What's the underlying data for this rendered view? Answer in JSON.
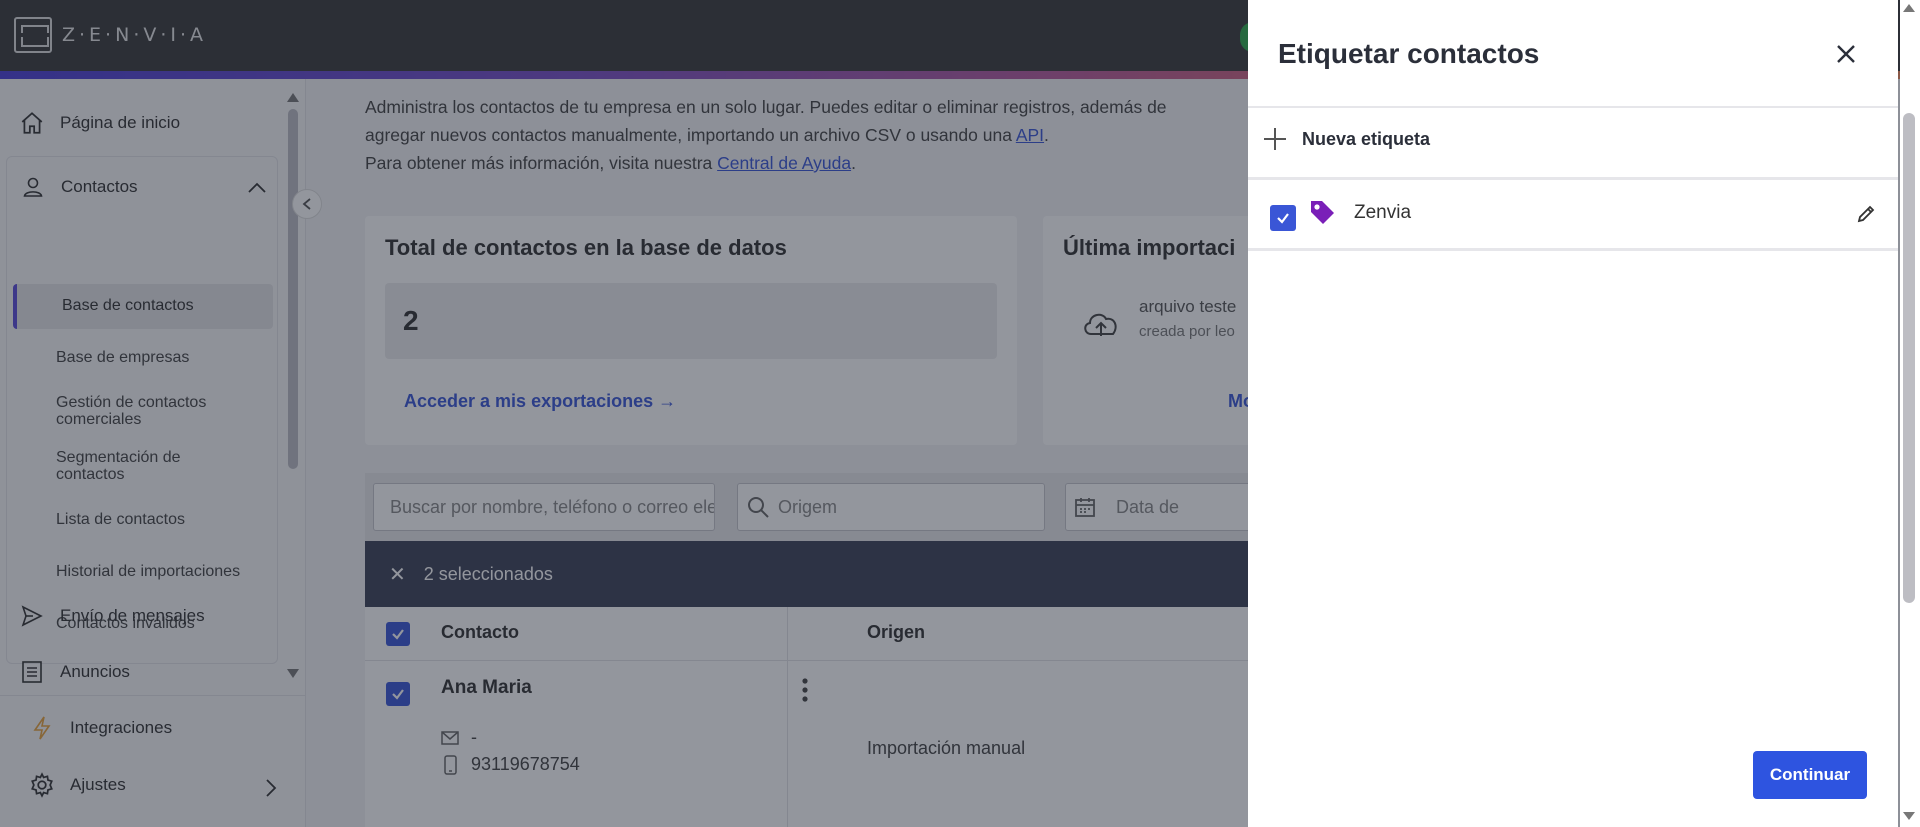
{
  "app": {
    "logo_text": "Z·E·N·V·I·A"
  },
  "sidebar": {
    "home": "Página de inicio",
    "contacts": "Contactos",
    "sub_items": [
      "Base de contactos",
      "Base de empresas",
      "Gestión de contactos comerciales",
      "Segmentación de contactos",
      "Lista de contactos",
      "Historial de importaciones",
      "Contactos inválidos"
    ],
    "messages": "Envío de mensajes",
    "ads": "Anuncios",
    "integrations": "Integraciones",
    "settings": "Ajustes"
  },
  "main": {
    "desc_line1": "Administra los contactos de tu empresa en un solo lugar. Puedes editar o eliminar registros, además de",
    "desc_line2_a": "agregar nuevos contactos manualmente, importando un archivo CSV o usando una ",
    "desc_line2_link": "API",
    "desc_line2_b": ".",
    "desc_line3_a": "Para obtener más información, visita nuestra ",
    "desc_line3_link": "Central de Ayuda",
    "desc_line3_b": ".",
    "card_total": {
      "title": "Total de contactos en la base de datos",
      "count": "2",
      "link": "Acceder a mis exportaciones →"
    },
    "card_last": {
      "title": "Última importaci",
      "file": "arquivo teste",
      "by": "creada por leo",
      "link": "Mo"
    },
    "filters": {
      "search_placeholder": "Buscar por nombre, teléfono o correo electrónico",
      "origin_placeholder": "Origem",
      "date_placeholder": "Data de"
    },
    "selection_text": "2 seleccionados",
    "table": {
      "col_contact": "Contacto",
      "col_origin": "Origen",
      "row": {
        "name": "Ana Maria",
        "email": "-",
        "phone": "93119678754",
        "origin": "Importación manual"
      }
    }
  },
  "drawer": {
    "title": "Etiquetar contactos",
    "new_tag": "Nueva etiqueta",
    "tags": [
      {
        "name": "Zenvia",
        "checked": true
      }
    ],
    "continue": "Continuar"
  },
  "colors": {
    "primary": "#2e54e0",
    "tag": "#7a1fb8",
    "selection_bar": "#3d4257"
  }
}
